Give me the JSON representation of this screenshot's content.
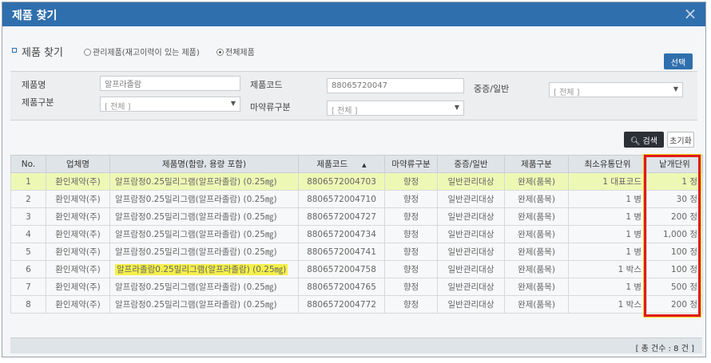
{
  "window": {
    "title": "제품 찾기",
    "close": "×"
  },
  "header": {
    "title": "제품 찾기",
    "radio_managed": "관리제품(재고이력이 있는 제품)",
    "radio_all": "전체제품",
    "select_button": "선택"
  },
  "filters": {
    "name_label": "제품명",
    "name_value": "알프라졸람",
    "code_label": "제품코드",
    "code_value": "88065720047",
    "severity_label": "중증/일반",
    "severity_value": "[ 전체 ]",
    "category_label": "제품구분",
    "category_value": "[ 전체 ]",
    "narcotic_label": "마약류구분",
    "narcotic_value": "[ 전체 ]"
  },
  "actions": {
    "search": "검색",
    "reset": "초기화"
  },
  "table": {
    "headers": [
      "No.",
      "업체명",
      "제품명(함량, 용량 포함)",
      "제품코드",
      "마약류구분",
      "중증/일반",
      "제품구분",
      "최소유통단위",
      "낱개단위"
    ],
    "rows": [
      [
        "1",
        "환인제약(주)",
        "알프람정0.25밀리그램(알프라졸람) (0.25㎎)",
        "8806572004703",
        "향정",
        "일반관리대상",
        "완제(품목)",
        "1 대표코드",
        "1 정"
      ],
      [
        "2",
        "환인제약(주)",
        "알프람정0.25밀리그램(알프라졸람) (0.25㎎)",
        "8806572004710",
        "향정",
        "일반관리대상",
        "완제(품목)",
        "1 병",
        "30 정"
      ],
      [
        "3",
        "환인제약(주)",
        "알프람정0.25밀리그램(알프라졸람) (0.25㎎)",
        "8806572004727",
        "향정",
        "일반관리대상",
        "완제(품목)",
        "1 병",
        "200 정"
      ],
      [
        "4",
        "환인제약(주)",
        "알프람정0.25밀리그램(알프라졸람) (0.25㎎)",
        "8806572004734",
        "향정",
        "일반관리대상",
        "완제(품목)",
        "1 병",
        "1,000 정"
      ],
      [
        "5",
        "환인제약(주)",
        "알프람정0.25밀리그램(알프라졸람) (0.25㎎)",
        "8806572004741",
        "향정",
        "일반관리대상",
        "완제(품목)",
        "1 병",
        "100 정"
      ],
      [
        "6",
        "환인제약(주)",
        "알프라졸람0.25밀리그램(알프라졸람) (0.25㎎)",
        "8806572004758",
        "향정",
        "일반관리대상",
        "완제(품목)",
        "1 박스",
        "100 정"
      ],
      [
        "7",
        "환인제약(주)",
        "알프람정0.25밀리그램(알프라졸람) (0.25㎎)",
        "8806572004765",
        "향정",
        "일반관리대상",
        "완제(품목)",
        "1 병",
        "500 정"
      ],
      [
        "8",
        "환인제약(주)",
        "알프람정0.25밀리그램(알프라졸람) (0.25㎎)",
        "8806572004772",
        "향정",
        "일반관리대상",
        "완제(품목)",
        "1 박스",
        "200 정"
      ]
    ]
  },
  "footer": {
    "count": "[ 총 건수 : 8 건 ]"
  },
  "colors": {
    "titlebar": "#2f6fad",
    "selected_row": "#eef8b5",
    "highlight": "#f5f04a",
    "annotation_box": "#e01b1b"
  },
  "icons": {
    "search": "magnifier-icon",
    "close": "close-icon",
    "sort": "sort-up-icon"
  }
}
